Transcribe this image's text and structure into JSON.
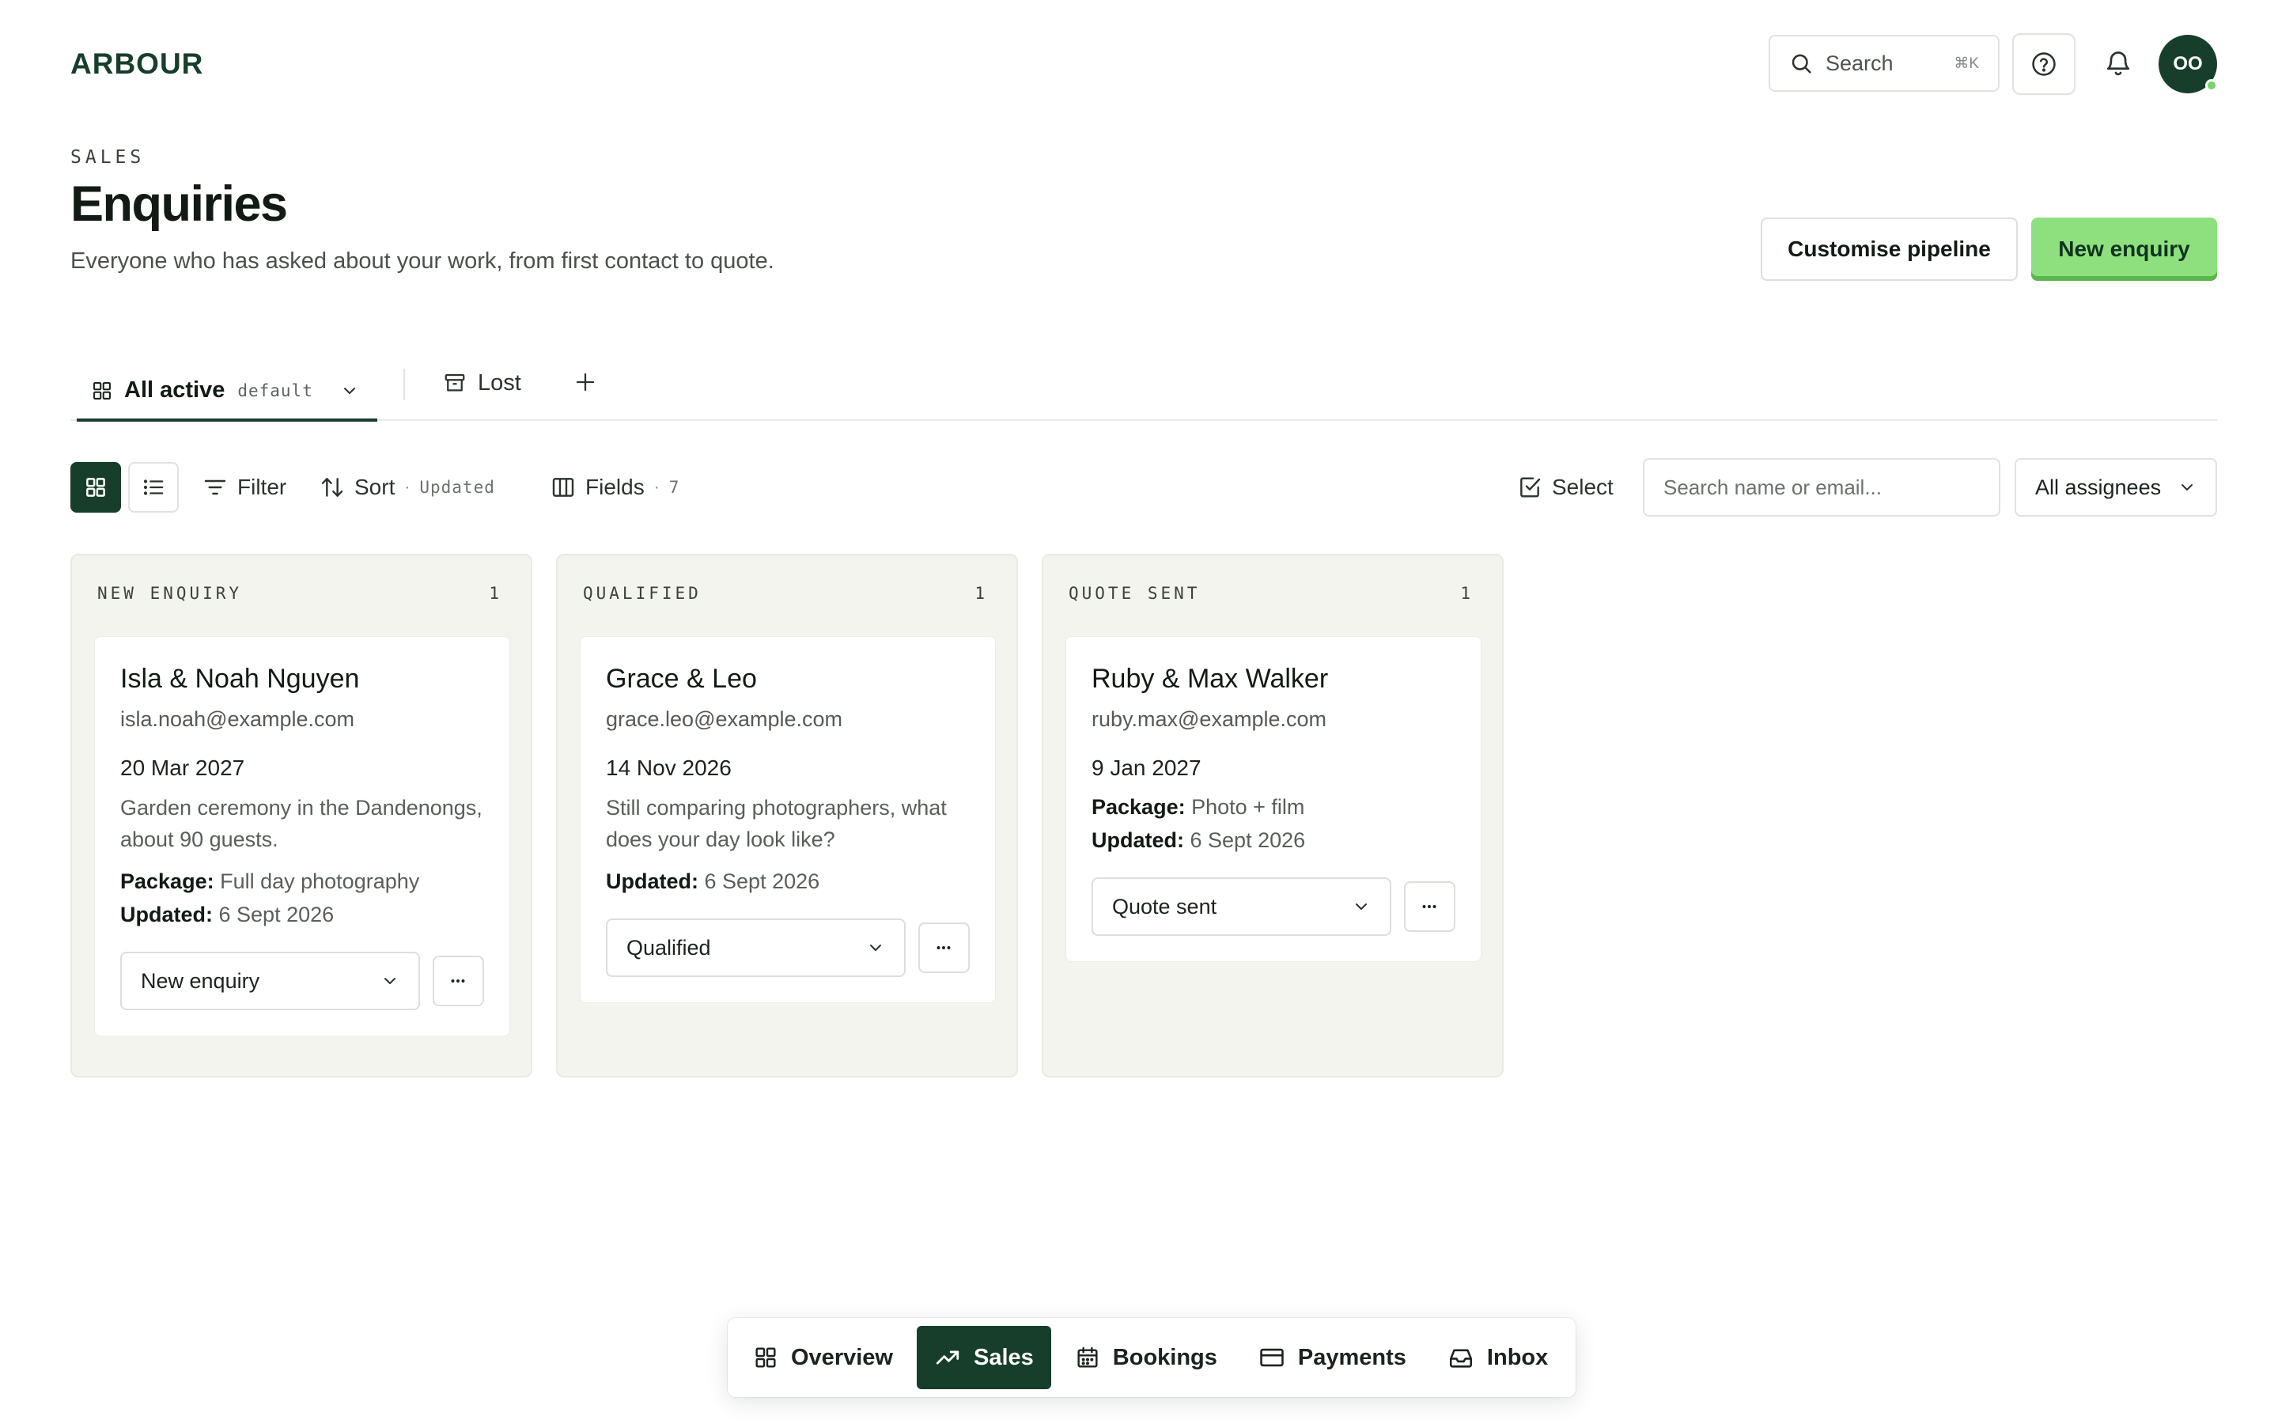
{
  "app": {
    "logo": "ARBOUR"
  },
  "header": {
    "search_label": "Search",
    "search_shortcut": "⌘K",
    "avatar_initials": "OO"
  },
  "page": {
    "eyebrow": "SALES",
    "title": "Enquiries",
    "subtitle": "Everyone who has asked about your work, from first contact to quote.",
    "customise_label": "Customise pipeline",
    "new_label": "New enquiry"
  },
  "tabs": {
    "active_label": "All active",
    "active_tag": "default",
    "lost_label": "Lost"
  },
  "toolbar": {
    "filter_label": "Filter",
    "sort_label": "Sort",
    "sort_value": "Updated",
    "fields_label": "Fields",
    "fields_count": "7",
    "select_label": "Select",
    "search_placeholder": "Search name or email...",
    "assignee_label": "All assignees"
  },
  "columns": [
    {
      "title": "NEW ENQUIRY",
      "count": "1",
      "card": {
        "name": "Isla & Noah Nguyen",
        "email": "isla.noah@example.com",
        "date": "20 Mar 2027",
        "note": "Garden ceremony in the Dandenongs, about 90 guests.",
        "package_label": "Package:",
        "package_value": "Full day photography",
        "updated_label": "Updated:",
        "updated_value": "6 Sept 2026",
        "status": "New enquiry"
      }
    },
    {
      "title": "QUALIFIED",
      "count": "1",
      "card": {
        "name": "Grace & Leo",
        "email": "grace.leo@example.com",
        "date": "14 Nov 2026",
        "note": "Still comparing photographers, what does your day look like?",
        "updated_label": "Updated:",
        "updated_value": "6 Sept 2026",
        "status": "Qualified"
      }
    },
    {
      "title": "QUOTE SENT",
      "count": "1",
      "card": {
        "name": "Ruby & Max Walker",
        "email": "ruby.max@example.com",
        "date": "9 Jan 2027",
        "package_label": "Package:",
        "package_value": "Photo + film",
        "updated_label": "Updated:",
        "updated_value": "6 Sept 2026",
        "status": "Quote sent"
      }
    }
  ],
  "bottom_nav": [
    {
      "label": "Overview",
      "icon": "grid-icon"
    },
    {
      "label": "Sales",
      "icon": "trending-up-icon",
      "active": true
    },
    {
      "label": "Bookings",
      "icon": "calendar-icon"
    },
    {
      "label": "Payments",
      "icon": "card-icon"
    },
    {
      "label": "Inbox",
      "icon": "inbox-icon"
    }
  ],
  "colors": {
    "brand": "#173e2a",
    "accent": "#8ee07e",
    "column_bg": "#f4f4ef",
    "online": "#76d26a"
  }
}
